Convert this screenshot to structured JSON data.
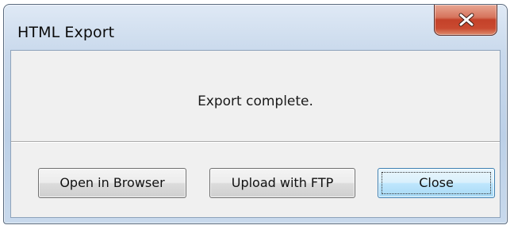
{
  "window": {
    "title": "HTML Export",
    "close_icon": "close-x-icon"
  },
  "dialog": {
    "message": "Export complete."
  },
  "buttons": {
    "open_in_browser": "Open in Browser",
    "upload_with_ftp": "Upload with FTP",
    "close": "Close"
  },
  "colors": {
    "titlebar": "#c9d9ec",
    "close_button": "#c44129",
    "client_background": "#f0f0f0",
    "default_button_border": "#3c7fb1"
  }
}
